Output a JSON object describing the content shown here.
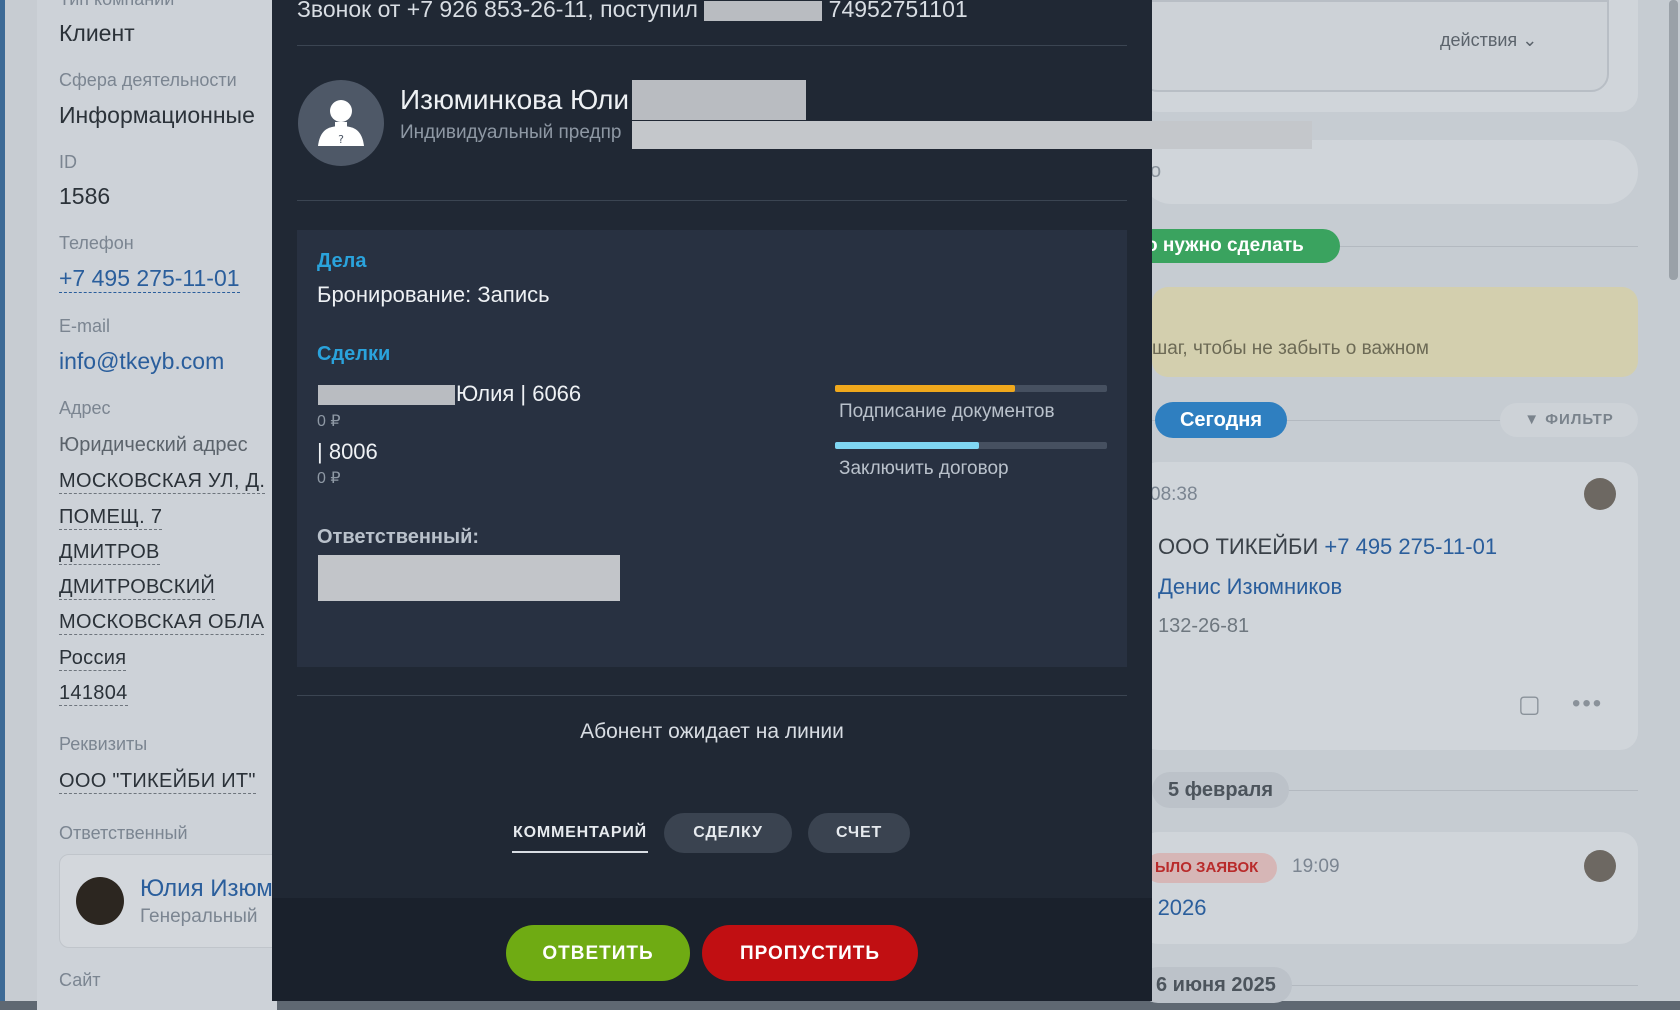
{
  "background_left": {
    "company_type_label": "Тип компании",
    "company_type": "Клиент",
    "industry_label": "Сфера деятельности",
    "industry": "Информационные",
    "id_label": "ID",
    "id": "1586",
    "phone_label": "Телефон",
    "phone": "+7 495 275-11-01",
    "email_label": "E-mail",
    "email": "info@tkeyb.com",
    "address_label": "Адрес",
    "address_type": "Юридический адрес",
    "address_lines": [
      "МОСКОВСКАЯ УЛ, Д.",
      "ПОМЕЩ. 7",
      "ДМИТРОВ",
      "ДМИТРОВСКИЙ",
      "МОСКОВСКАЯ ОБЛА",
      "Россия",
      "141804"
    ],
    "requisites_label": "Реквизиты",
    "requisites": "ООО \"ТИКЕЙБИ ИТ\"",
    "responsible_label": "Ответственный",
    "responsible_name": "Юлия Изюм",
    "responsible_role": "Генеральный",
    "site_label": "Сайт"
  },
  "background_right": {
    "actions_label": "действия",
    "search_hint": "о",
    "todo_pill": "о нужно сделать",
    "note_hint": "шаг, чтобы не забыть о важном",
    "today_pill": "Сегодня",
    "filter_label": "ФИЛЬТР",
    "activity_time": "08:38",
    "activity_company": "ООО ТИКЕЙБИ",
    "activity_phone": "+7 495 275-11-01",
    "activity_person": "Денис Изюмников",
    "activity_extra": "132-26-81",
    "date_feb": "5 февраля",
    "red_badge": "ЫЛО ЗАЯВОК",
    "activity2_time": "19:09",
    "activity2_text": "ь 2026",
    "date_jun": "6 июня 2025"
  },
  "call": {
    "title_prefix": "Звонок от +7 926 853-26-11, поступил",
    "title_suffix": "74952751101",
    "caller_name": "Изюминкова Юли",
    "caller_subtitle": "Индивидуальный предпр",
    "affairs_title": "Дела",
    "affair_item": "Бронирование: Запись",
    "deals_title": "Сделки",
    "deals": [
      {
        "name": "Юлия | 6066",
        "amount": "0 ₽",
        "stage": "Подписание документов",
        "progress": 0.66,
        "color": "#f0a81c"
      },
      {
        "name": "| 8006",
        "amount": "0 ₽",
        "stage": "Заключить договор",
        "progress": 0.53,
        "color": "#7fd6f2"
      }
    ],
    "responsible_title": "Ответственный:",
    "waiting_text": "Абонент ожидает на линии",
    "tabs": [
      "КОММЕНТАРИЙ",
      "СДЕЛКУ",
      "СЧЕТ"
    ],
    "answer_button": "ОТВЕТИТЬ",
    "skip_button": "ПРОПУСТИТЬ"
  }
}
